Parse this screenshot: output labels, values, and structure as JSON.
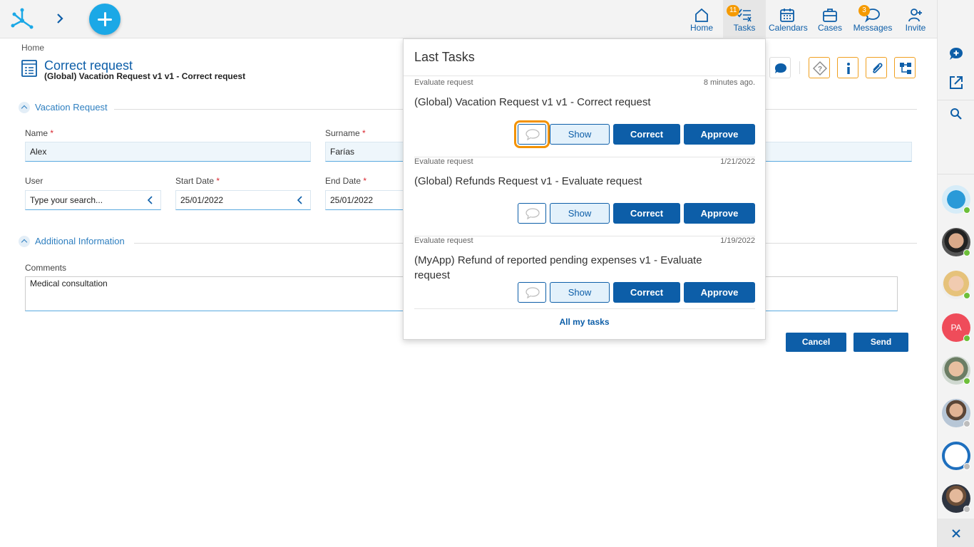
{
  "header": {
    "nav": [
      {
        "id": "home",
        "label": "Home",
        "icon": "home-icon"
      },
      {
        "id": "tasks",
        "label": "Tasks",
        "icon": "tasks-icon",
        "badge": "11"
      },
      {
        "id": "calendars",
        "label": "Calendars",
        "icon": "calendar-icon"
      },
      {
        "id": "cases",
        "label": "Cases",
        "icon": "briefcase-icon"
      },
      {
        "id": "messages",
        "label": "Messages",
        "icon": "chat-icon",
        "badge": "3"
      },
      {
        "id": "invite",
        "label": "Invite",
        "icon": "add-user-icon"
      }
    ]
  },
  "page": {
    "breadcrumb": "Home",
    "title": "Correct request",
    "subtitle": "(Global) Vacation Request v1 v1 - Correct request"
  },
  "form": {
    "section1": "Vacation Request",
    "section2": "Additional Information",
    "name_label": "Name",
    "name_value": "Alex",
    "surname_label": "Surname",
    "surname_value": "Farías",
    "user_label": "User",
    "user_placeholder": "Type your search...",
    "start_label": "Start Date",
    "start_value": "25/01/2022",
    "end_label": "End Date",
    "end_value": "25/01/2022",
    "comments_label": "Comments",
    "comments_value": "Medical consultation",
    "required_mark": "*",
    "cancel": "Cancel",
    "send": "Send"
  },
  "popup": {
    "title": "Last Tasks",
    "tasks": [
      {
        "name": "Evaluate request",
        "date": "8 minutes ago.",
        "title": "(Global) Vacation Request v1 v1 - Correct request"
      },
      {
        "name": "Evaluate request",
        "date": "1/21/2022",
        "title": "(Global) Refunds Request v1 - Evaluate request"
      },
      {
        "name": "Evaluate request",
        "date": "1/19/2022",
        "title": "(MyApp) Refund of reported pending expenses v1 - Evaluate request"
      }
    ],
    "show_label": "Show",
    "correct_label": "Correct",
    "approve_label": "Approve",
    "all_tasks": "All my tasks"
  },
  "rail": {
    "people_initials": "PA"
  },
  "colors": {
    "primary": "#0d5ea8",
    "accent": "#1ba8e6",
    "highlight": "#f39200",
    "badge": "#f59a00",
    "online": "#6dbf3a"
  }
}
